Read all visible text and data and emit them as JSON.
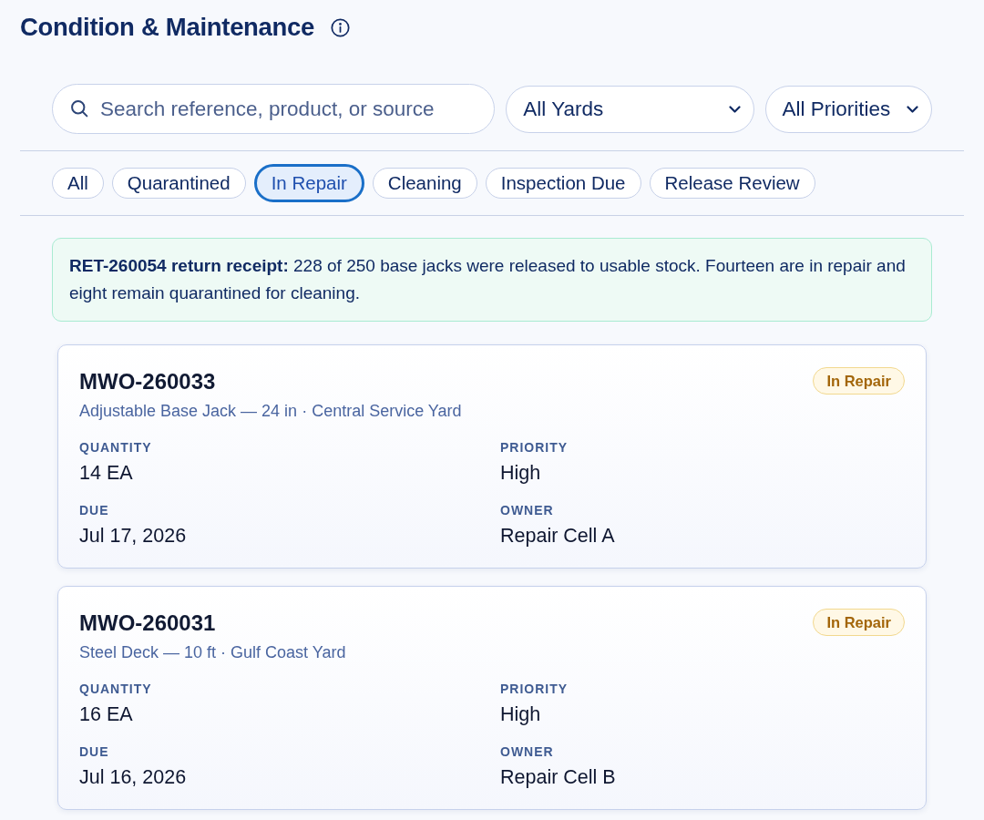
{
  "header": {
    "title": "Condition & Maintenance"
  },
  "search": {
    "placeholder": "Search reference, product, or source"
  },
  "filters": [
    {
      "value": "All Yards"
    },
    {
      "value": "All Priorities"
    }
  ],
  "status_tabs": [
    {
      "label": "All",
      "selected": false
    },
    {
      "label": "Quarantined",
      "selected": false
    },
    {
      "label": "In Repair",
      "selected": true
    },
    {
      "label": "Cleaning",
      "selected": false
    },
    {
      "label": "Inspection Due",
      "selected": false
    },
    {
      "label": "Release Review",
      "selected": false
    }
  ],
  "notice": {
    "text": "**RET-260054 return receipt:** 228 of 250 base jacks were released to usable stock. Fourteen are in repair and eight remain quarantined for cleaning."
  },
  "work_orders": [
    {
      "id": "MWO-260033",
      "subtitle": "Adjustable Base Jack — 24 in · Central Service Yard",
      "status": "In Repair",
      "fields": [
        {
          "label": "QUANTITY",
          "value": "14 EA"
        },
        {
          "label": "PRIORITY",
          "value": "High"
        },
        {
          "label": "DUE",
          "value": "Jul 17, 2026"
        },
        {
          "label": "OWNER",
          "value": "Repair Cell A"
        }
      ]
    },
    {
      "id": "MWO-260031",
      "subtitle": "Steel Deck — 10 ft · Gulf Coast Yard",
      "status": "In Repair",
      "fields": [
        {
          "label": "QUANTITY",
          "value": "16 EA"
        },
        {
          "label": "PRIORITY",
          "value": "High"
        },
        {
          "label": "DUE",
          "value": "Jul 16, 2026"
        },
        {
          "label": "OWNER",
          "value": "Repair Cell B"
        }
      ]
    }
  ]
}
